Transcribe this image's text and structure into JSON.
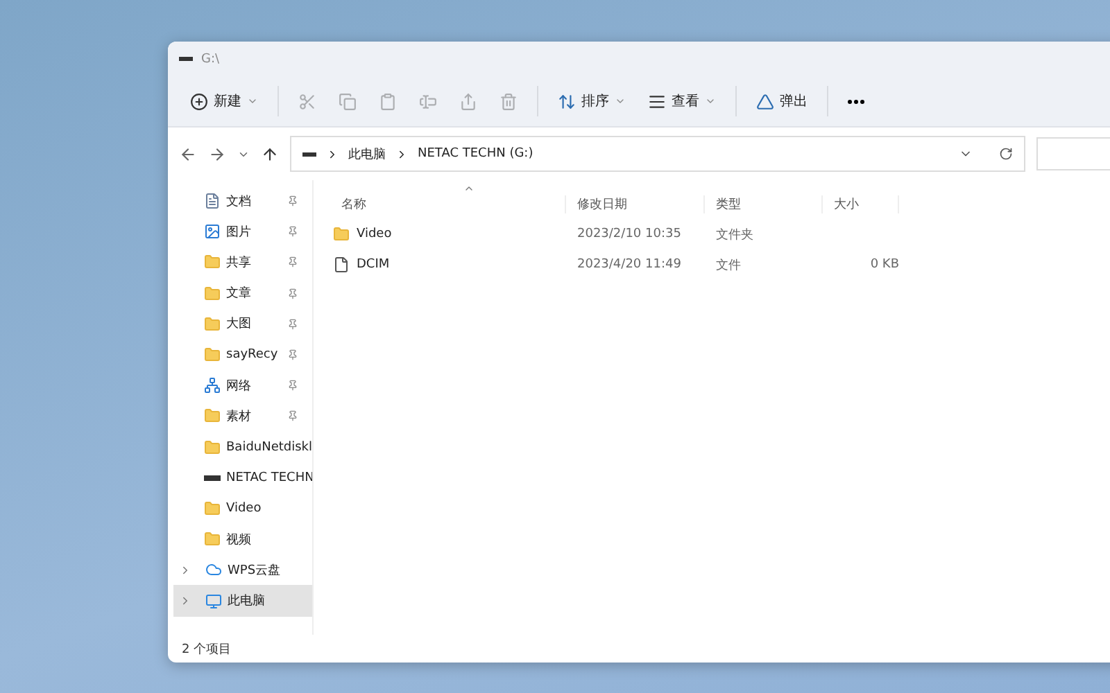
{
  "window": {
    "title": "G:\\"
  },
  "toolbar": [
    {
      "kind": "new",
      "label": "新建",
      "disabled": false
    },
    {
      "kind": "cut",
      "disabled": true
    },
    {
      "kind": "copy",
      "disabled": true
    },
    {
      "kind": "paste",
      "disabled": true
    },
    {
      "kind": "rename",
      "disabled": true
    },
    {
      "kind": "share",
      "disabled": true
    },
    {
      "kind": "delete",
      "disabled": true
    },
    {
      "kind": "sort",
      "label": "排序",
      "disabled": false
    },
    {
      "kind": "view",
      "label": "查看",
      "disabled": false
    },
    {
      "kind": "eject",
      "label": "弹出",
      "disabled": false
    },
    {
      "kind": "more",
      "disabled": false
    }
  ],
  "address": {
    "path": [
      "此电脑",
      "NETAC TECHN (G:)"
    ]
  },
  "sidebar": {
    "items": [
      {
        "kind": "doc",
        "label": "文档",
        "pinned": true,
        "expandable": false,
        "selected": false
      },
      {
        "kind": "picture",
        "label": "图片",
        "pinned": true,
        "expandable": false,
        "selected": false
      },
      {
        "kind": "folder",
        "label": "共享",
        "pinned": true,
        "expandable": false,
        "selected": false
      },
      {
        "kind": "folder",
        "label": "文章",
        "pinned": true,
        "expandable": false,
        "selected": false
      },
      {
        "kind": "folder",
        "label": "大图",
        "pinned": true,
        "expandable": false,
        "selected": false
      },
      {
        "kind": "folder",
        "label": "sayRecy",
        "pinned": true,
        "expandable": false,
        "selected": false
      },
      {
        "kind": "network",
        "label": "网络",
        "pinned": true,
        "expandable": false,
        "selected": false
      },
      {
        "kind": "folder",
        "label": "素材",
        "pinned": true,
        "expandable": false,
        "selected": false
      },
      {
        "kind": "folder",
        "label": "BaiduNetdiskl",
        "pinned": false,
        "expandable": false,
        "selected": false
      },
      {
        "kind": "drive",
        "label": "NETAC TECHN",
        "pinned": false,
        "expandable": false,
        "selected": false
      },
      {
        "kind": "folder",
        "label": "Video",
        "pinned": false,
        "expandable": false,
        "selected": false
      },
      {
        "kind": "folder",
        "label": "视频",
        "pinned": false,
        "expandable": false,
        "selected": false
      },
      {
        "kind": "cloud",
        "label": "WPS云盘",
        "pinned": false,
        "expandable": true,
        "selected": false
      },
      {
        "kind": "pc",
        "label": "此电脑",
        "pinned": false,
        "expandable": true,
        "selected": true
      }
    ]
  },
  "table": {
    "columns": [
      "名称",
      "修改日期",
      "类型",
      "大小"
    ],
    "rows": [
      {
        "kind": "folder",
        "name": "Video",
        "date": "2023/2/10 10:35",
        "type": "文件夹",
        "size": ""
      },
      {
        "kind": "file",
        "name": "DCIM",
        "date": "2023/4/20 11:49",
        "type": "文件",
        "size": "0 KB"
      }
    ]
  },
  "status_bar": {
    "count": "2 个项目"
  }
}
